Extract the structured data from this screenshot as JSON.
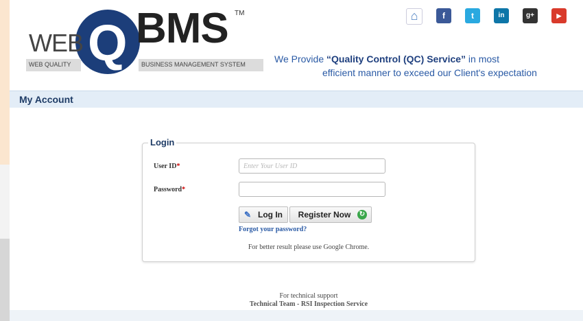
{
  "header": {
    "logo": {
      "web": "WEB",
      "q": "Q",
      "bms": "BMS",
      "tm": "TM",
      "sub_left": "WEB QUALITY",
      "sub_right": "BUSINESS MANAGEMENT SYSTEM"
    },
    "social_icons": [
      {
        "name": "home-icon",
        "glyph": "⌂",
        "color": "#ffffff"
      },
      {
        "name": "facebook-icon",
        "glyph": "f",
        "color": "#3b5998"
      },
      {
        "name": "twitter-icon",
        "glyph": "t",
        "color": "#2aa9e0"
      },
      {
        "name": "linkedin-icon",
        "glyph": "in",
        "color": "#0e76a8"
      },
      {
        "name": "google-plus-icon",
        "glyph": "g+",
        "color": "#333333"
      },
      {
        "name": "youtube-icon",
        "glyph": "▶",
        "color": "#d93a2b"
      }
    ],
    "tagline": {
      "prefix": "We Provide ",
      "highlight": "“Quality Control (QC) Service”",
      "suffix": " in most",
      "line2": "efficient manner to exceed our Client's expectation"
    }
  },
  "account_bar": {
    "title": "My Account"
  },
  "login": {
    "legend": "Login",
    "user_id_label": "User ID",
    "user_id_placeholder": "Enter Your User ID",
    "password_label": "Password",
    "required_mark": "*",
    "login_button": "Log In",
    "register_button": "Register Now",
    "forgot_link": "Forgot your password?",
    "browser_note": "For better result please use Google Chrome."
  },
  "support": {
    "line1": "For technical support",
    "line2": "Technical Team - RSI Inspection Service"
  },
  "colors": {
    "brand_blue": "#1c3e7a",
    "link_blue": "#2a5aa5",
    "required_red": "#cc0000",
    "side_panel_orange": "#fbe6cf"
  }
}
